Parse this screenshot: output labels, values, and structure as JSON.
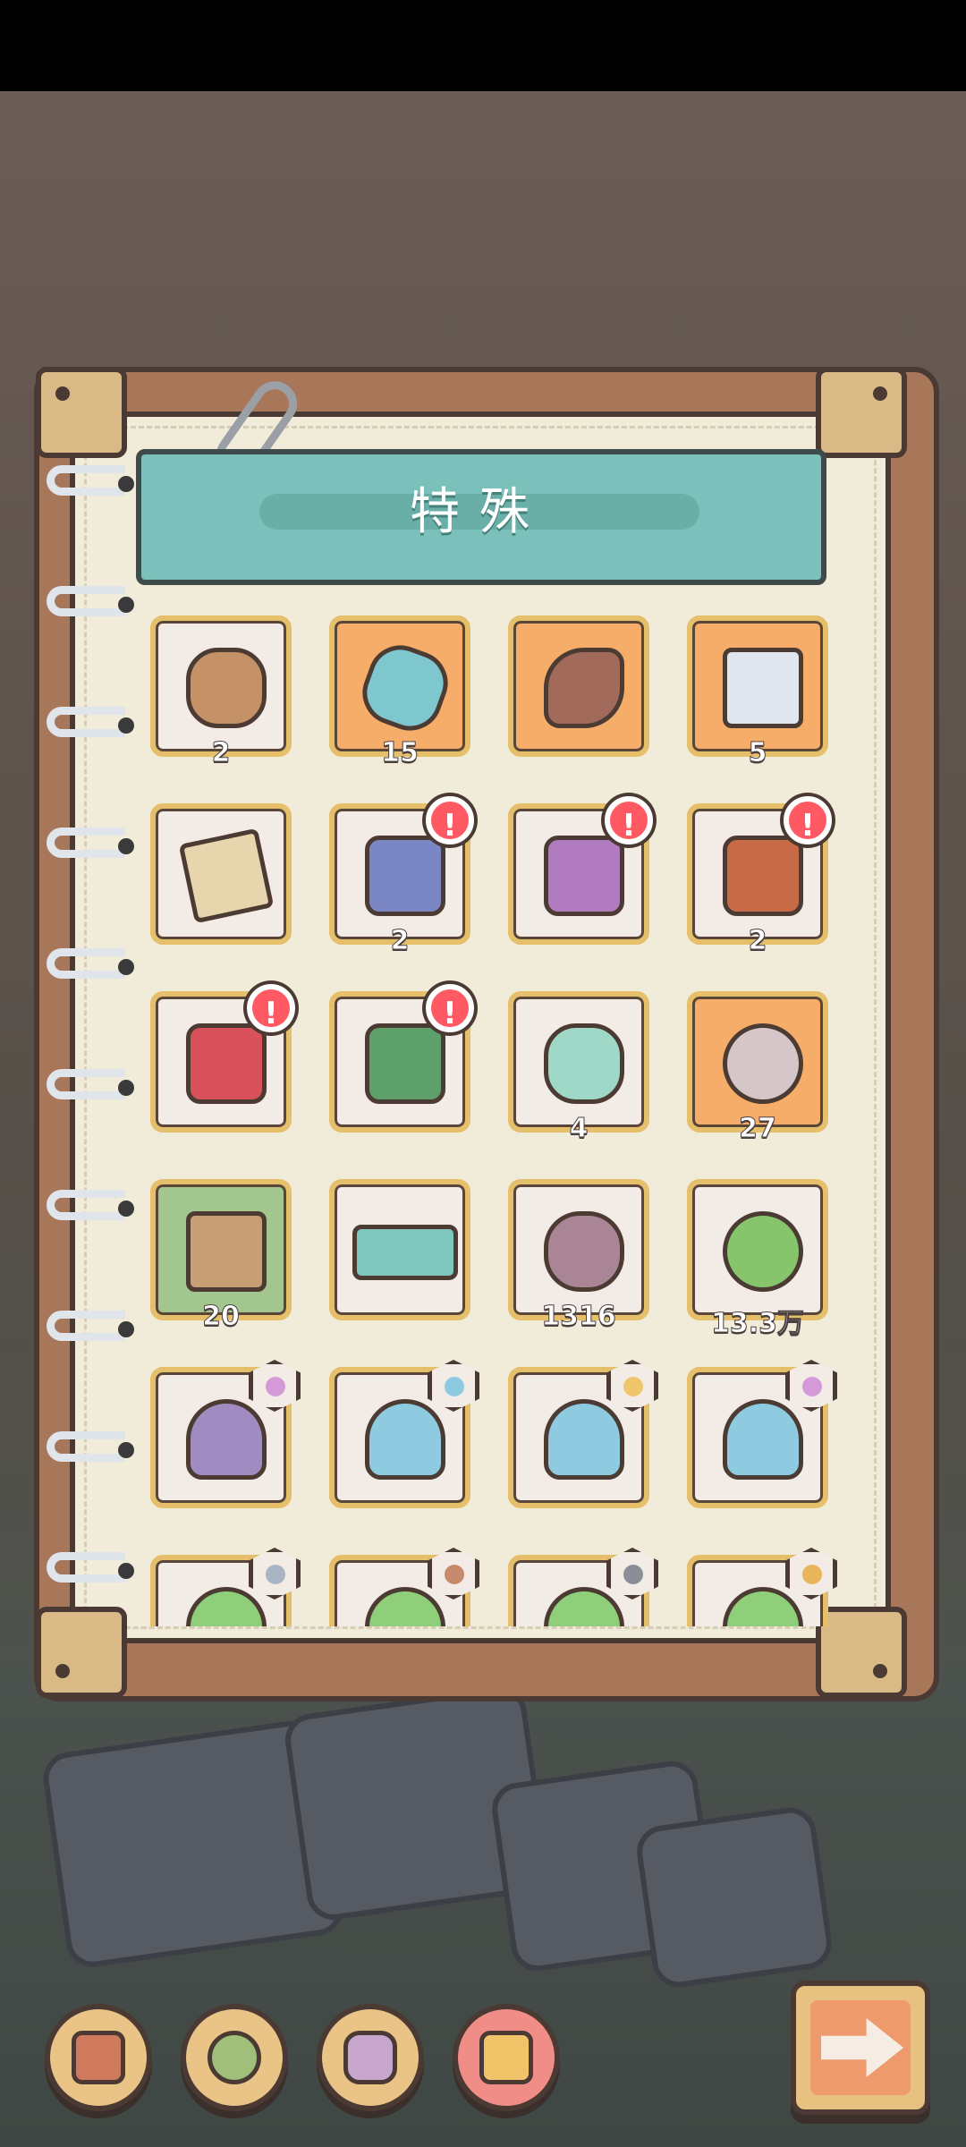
{
  "page_title": "特殊",
  "grid": [
    {
      "count": "2",
      "icon": "poop-icon",
      "bg": "plain"
    },
    {
      "count": "15",
      "icon": "robot-gadget-icon",
      "bg": "orange"
    },
    {
      "count": "",
      "icon": "root-vegetable-icon",
      "bg": "orange"
    },
    {
      "count": "5",
      "icon": "snack-bag-icon",
      "bg": "orange"
    },
    {
      "count": "",
      "icon": "map-scroll-icon",
      "bg": "plain"
    },
    {
      "count": "2",
      "icon": "blue-can-icon",
      "bg": "plain",
      "alert": "!"
    },
    {
      "count": "",
      "icon": "purple-can-icon",
      "bg": "plain",
      "alert": "!"
    },
    {
      "count": "2",
      "icon": "orange-can-icon",
      "bg": "plain",
      "alert": "!"
    },
    {
      "count": "",
      "icon": "red-can-icon",
      "bg": "plain",
      "alert": "!"
    },
    {
      "count": "",
      "icon": "green-can-icon",
      "bg": "plain",
      "alert": "!"
    },
    {
      "count": "4",
      "icon": "lantern-jar-icon",
      "bg": "plain"
    },
    {
      "count": "27",
      "icon": "spotted-orb-icon",
      "bg": "orange"
    },
    {
      "count": "20",
      "icon": "seed-bag-icon",
      "bg": "green"
    },
    {
      "count": "",
      "icon": "ticket-card-icon",
      "bg": "plain"
    },
    {
      "count": "1316",
      "icon": "coin-pouch-icon",
      "bg": "plain"
    },
    {
      "count": "13.3万",
      "icon": "mushroom-potion-icon",
      "bg": "plain"
    },
    {
      "count": "",
      "icon": "purple-mushroom-icon",
      "bg": "plain",
      "badge": "flower-badge-icon"
    },
    {
      "count": "",
      "icon": "blue-mushroom-icon",
      "bg": "plain",
      "badge": "cross-badge-icon"
    },
    {
      "count": "",
      "icon": "blue-mushroom-icon",
      "bg": "plain",
      "badge": "chair-badge-icon"
    },
    {
      "count": "",
      "icon": "blue-mushroom-icon",
      "bg": "plain",
      "badge": "flower-badge-icon"
    },
    {
      "count": "",
      "icon": "green-blob-icon",
      "bg": "plain",
      "badge": "pill-badge-icon"
    },
    {
      "count": "",
      "icon": "green-blob-icon",
      "bg": "plain",
      "badge": "feather-badge-icon"
    },
    {
      "count": "",
      "icon": "green-blob-icon",
      "bg": "plain",
      "badge": "stone-badge-icon"
    },
    {
      "count": "",
      "icon": "green-blob-icon",
      "bg": "plain",
      "badge": "trophy-badge-icon"
    }
  ],
  "bottom_nav": [
    {
      "name": "backpack-tab",
      "icon": "backpack-icon"
    },
    {
      "name": "plant-tab",
      "icon": "branch-icon"
    },
    {
      "name": "gear-tab",
      "icon": "gear-skull-icon"
    },
    {
      "name": "chest-tab",
      "icon": "treasure-chest-icon"
    }
  ],
  "colors": {
    "banner": "#7cc0bb",
    "slot_border": "#e6bf6a",
    "orange_slot": "#f7ad6a",
    "green_slot": "#a3c68e",
    "alert": "#ff5a64"
  }
}
